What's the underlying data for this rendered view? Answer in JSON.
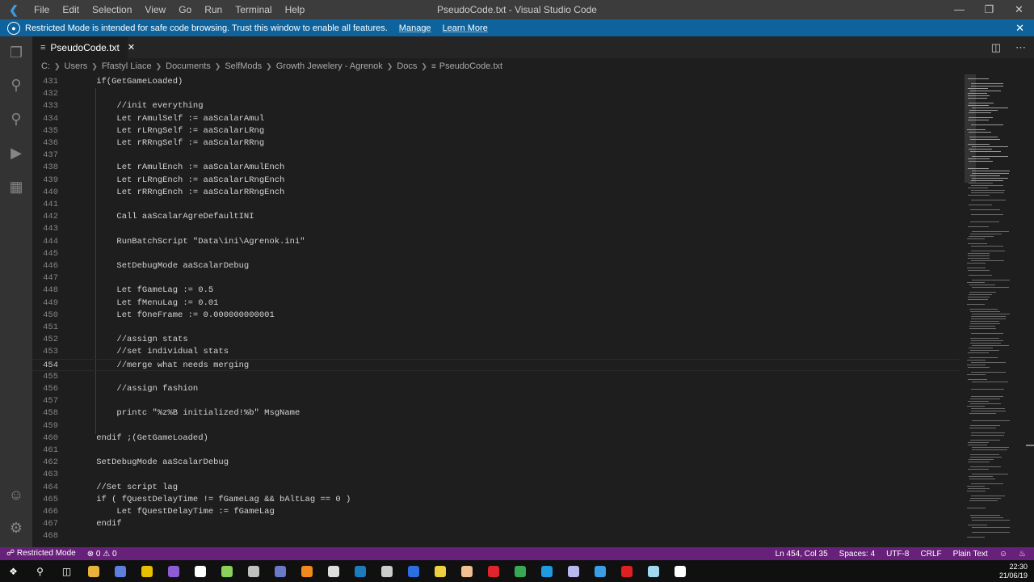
{
  "titlebar": {
    "menus": [
      "File",
      "Edit",
      "Selection",
      "View",
      "Go",
      "Run",
      "Terminal",
      "Help"
    ],
    "title": "PseudoCode.txt - Visual Studio Code"
  },
  "banner": {
    "message": "Restricted Mode is intended for safe code browsing. Trust this window to enable all features.",
    "manage_label": "Manage",
    "learn_more_label": "Learn More"
  },
  "tab": {
    "label": "PseudoCode.txt"
  },
  "breadcrumb": [
    "C:",
    "Users",
    "Ffastyl Liace",
    "Documents",
    "SelfMods",
    "Growth Jewelery - Agrenok",
    "Docs",
    "PseudoCode.txt"
  ],
  "editor": {
    "current_line": 454,
    "lines": [
      {
        "n": "431",
        "t": "    if(GetGameLoaded)"
      },
      {
        "n": "432",
        "t": ""
      },
      {
        "n": "433",
        "t": "        //init everything"
      },
      {
        "n": "434",
        "t": "        Let rAmulSelf := aaScalarAmul"
      },
      {
        "n": "435",
        "t": "        Let rLRngSelf := aaScalarLRng"
      },
      {
        "n": "436",
        "t": "        Let rRRngSelf := aaScalarRRng"
      },
      {
        "n": "437",
        "t": ""
      },
      {
        "n": "438",
        "t": "        Let rAmulEnch := aaScalarAmulEnch"
      },
      {
        "n": "439",
        "t": "        Let rLRngEnch := aaScalarLRngEnch"
      },
      {
        "n": "440",
        "t": "        Let rRRngEnch := aaScalarRRngEnch"
      },
      {
        "n": "441",
        "t": ""
      },
      {
        "n": "442",
        "t": "        Call aaScalarAgreDefaultINI"
      },
      {
        "n": "443",
        "t": ""
      },
      {
        "n": "444",
        "t": "        RunBatchScript \"Data\\ini\\Agrenok.ini\""
      },
      {
        "n": "445",
        "t": ""
      },
      {
        "n": "446",
        "t": "        SetDebugMode aaScalarDebug"
      },
      {
        "n": "447",
        "t": ""
      },
      {
        "n": "448",
        "t": "        Let fGameLag := 0.5"
      },
      {
        "n": "449",
        "t": "        Let fMenuLag := 0.01"
      },
      {
        "n": "450",
        "t": "        Let fOneFrame := 0.000000000001"
      },
      {
        "n": "451",
        "t": ""
      },
      {
        "n": "452",
        "t": "        //assign stats"
      },
      {
        "n": "453",
        "t": "        //set individual stats"
      },
      {
        "n": "454",
        "t": "        //merge what needs merging"
      },
      {
        "n": "455",
        "t": ""
      },
      {
        "n": "456",
        "t": "        //assign fashion"
      },
      {
        "n": "457",
        "t": ""
      },
      {
        "n": "458",
        "t": "        printc \"%z%B initialized!%b\" MsgName"
      },
      {
        "n": "459",
        "t": ""
      },
      {
        "n": "460",
        "t": "    endif ;(GetGameLoaded)"
      },
      {
        "n": "461",
        "t": ""
      },
      {
        "n": "462",
        "t": "    SetDebugMode aaScalarDebug"
      },
      {
        "n": "463",
        "t": ""
      },
      {
        "n": "464",
        "t": "    //Set script lag"
      },
      {
        "n": "465",
        "t": "    if ( fQuestDelayTime != fGameLag && bAltLag == 0 )"
      },
      {
        "n": "466",
        "t": "        Let fQuestDelayTime := fGameLag"
      },
      {
        "n": "467",
        "t": "    endif"
      },
      {
        "n": "468",
        "t": ""
      }
    ]
  },
  "status": {
    "mode": "Restricted Mode",
    "errors": "0",
    "warnings": "0",
    "position": "Ln 454, Col 35",
    "spaces": "Spaces: 4",
    "encoding": "UTF-8",
    "eol": "CRLF",
    "language": "Plain Text"
  },
  "taskbar": {
    "time": "22:30",
    "date": "21/06/19"
  }
}
